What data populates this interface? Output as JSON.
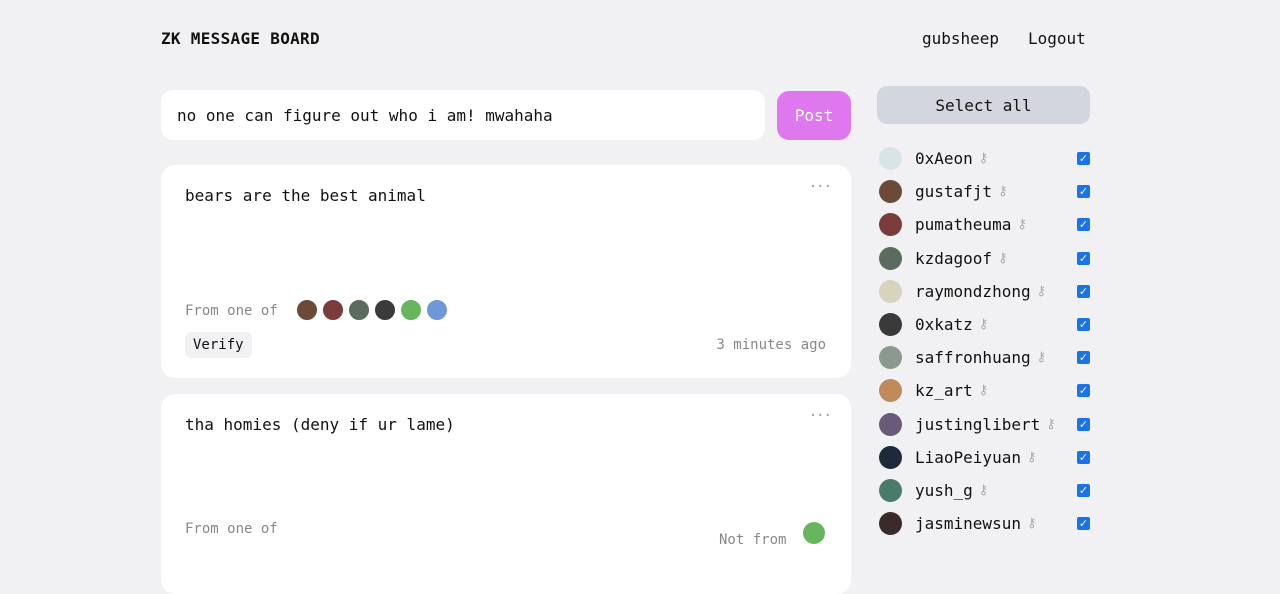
{
  "header": {
    "brand": "ZK MESSAGE BOARD",
    "username": "gubsheep",
    "logout_label": "Logout"
  },
  "composer": {
    "value": "no one can figure out who i am! mwahaha",
    "post_label": "Post"
  },
  "posts": [
    {
      "text": "bears are the best animal",
      "more": "···",
      "from_label": "From one of",
      "verify_label": "Verify",
      "time": "3 minutes ago",
      "avatar_colors": [
        "#6b4a3a",
        "#7a3b3b",
        "#5b6b5e",
        "#3a3a3a",
        "#67b65d",
        "#6f98d8"
      ]
    },
    {
      "text": "tha homies (deny if ur lame)",
      "more": "···",
      "from_label": "From one of",
      "not_from_label": "Not from",
      "not_from_avatar_color": "#67b65d"
    }
  ],
  "sidebar": {
    "select_all_label": "Select all",
    "key_icon": "key-icon",
    "users": [
      {
        "name": "0xAeon",
        "color": "#d9e4e8",
        "checked": true
      },
      {
        "name": "gustafjt",
        "color": "#6b4a3a",
        "checked": true
      },
      {
        "name": "pumatheuma",
        "color": "#7a3b3b",
        "checked": true
      },
      {
        "name": "kzdagoof",
        "color": "#5b6b5e",
        "checked": true
      },
      {
        "name": "raymondzhong",
        "color": "#d9d2bf",
        "checked": true
      },
      {
        "name": "0xkatz",
        "color": "#3a3a3a",
        "checked": true
      },
      {
        "name": "saffronhuang",
        "color": "#8a9a8e",
        "checked": true
      },
      {
        "name": "kz_art",
        "color": "#c08a5b",
        "checked": true
      },
      {
        "name": "justinglibert",
        "color": "#6a5a7a",
        "checked": true
      },
      {
        "name": "LiaoPeiyuan",
        "color": "#1c2a3a",
        "checked": true
      },
      {
        "name": "yush_g",
        "color": "#4a7a6a",
        "checked": true
      },
      {
        "name": "jasminewsun",
        "color": "#3a2a2a",
        "checked": true
      }
    ]
  },
  "colors": {
    "accent": "#df78ef",
    "checkbox": "#1a73e8",
    "background": "#f1f1f3"
  }
}
